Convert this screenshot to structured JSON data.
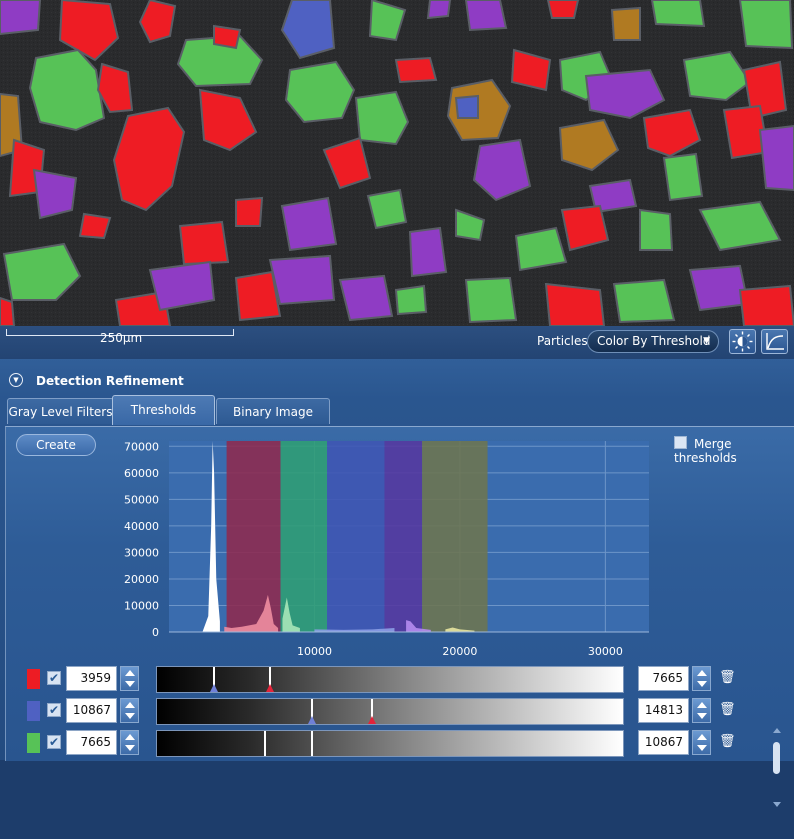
{
  "scalebar": {
    "label": "250µm"
  },
  "particles": {
    "label": "Particles:",
    "selected": "Color By Threshold"
  },
  "icons": {
    "brightness": "brightness-icon",
    "curve": "curve-icon",
    "collapse": "collapse-arrow-icon",
    "trash": "trash-icon",
    "checkmark": "checkmark-icon"
  },
  "section": {
    "title": "Detection Refinement"
  },
  "tabs": [
    {
      "label": "Gray Level Filters",
      "active": false
    },
    {
      "label": "Thresholds",
      "active": true
    },
    {
      "label": "Binary Image Filters",
      "active": false
    }
  ],
  "create_label": "Create",
  "merge_label": "Merge thresholds",
  "chart_data": {
    "type": "area",
    "xlim": [
      0,
      33000
    ],
    "ylim": [
      0,
      72000
    ],
    "x_ticks": [
      10000,
      20000,
      30000
    ],
    "x_tick_labels": [
      "10000",
      "20000",
      "30000"
    ],
    "y_ticks": [
      0,
      10000,
      20000,
      30000,
      40000,
      50000,
      60000,
      70000
    ],
    "y_tick_labels": [
      "0",
      "10000",
      "20000",
      "30000",
      "40000",
      "50000",
      "60000",
      "70000"
    ],
    "grid": true,
    "bands": [
      {
        "from": 3959,
        "to": 7665,
        "color": "#8e2a4e"
      },
      {
        "from": 7665,
        "to": 10867,
        "color": "#2f9e74"
      },
      {
        "from": 10867,
        "to": 14813,
        "color": "#3f55b3"
      },
      {
        "from": 14813,
        "to": 17400,
        "color": "#55389f"
      },
      {
        "from": 17400,
        "to": 21900,
        "color": "#6d7550"
      }
    ],
    "histogram": {
      "x": [
        2300,
        2700,
        2900,
        3000,
        3100,
        3250,
        3500,
        3800,
        4300,
        5000,
        6000,
        6500,
        6800,
        7000,
        7200,
        7500,
        7800,
        8100,
        8300,
        8500,
        9000,
        10000,
        12000,
        14000,
        15500,
        16300,
        16600,
        17000,
        18000,
        19000,
        19500,
        20000,
        21000
      ],
      "y": [
        0,
        6000,
        40000,
        75000,
        60000,
        20000,
        4000,
        2000,
        1500,
        2000,
        3000,
        8000,
        14000,
        9000,
        3000,
        1500,
        5000,
        13000,
        7000,
        2500,
        1500,
        1000,
        800,
        1000,
        1500,
        4500,
        4000,
        1500,
        800,
        1000,
        1700,
        1000,
        500
      ],
      "colors": [
        "#ffffff",
        "#ee8da0",
        "#a8e5b8",
        "#8c9fe6",
        "#b58cf0",
        "#e8e5a0"
      ]
    }
  },
  "threshold_rows": [
    {
      "color": "#ed1c24",
      "low": "3959",
      "high": "7665",
      "markers": [
        0.12,
        0.24
      ]
    },
    {
      "color": "#4f61c2",
      "low": "10867",
      "high": "14813",
      "markers": [
        0.33,
        0.46
      ]
    },
    {
      "color": "#57c257",
      "low": "7665",
      "high": "10867",
      "markers": [
        0.23,
        0.33
      ]
    }
  ]
}
